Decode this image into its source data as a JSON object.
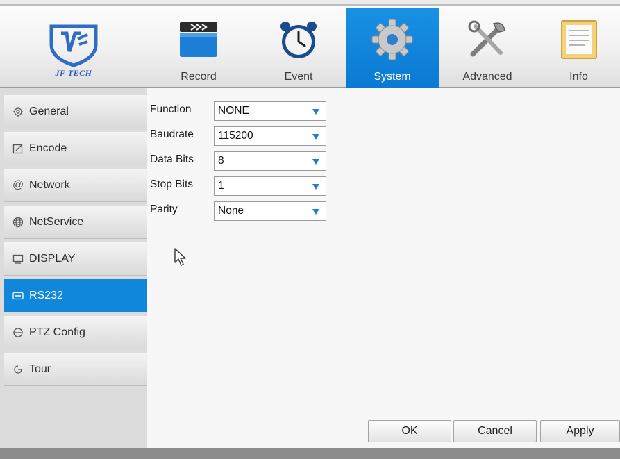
{
  "brand": {
    "logo_text": "JF TECH"
  },
  "tabs": [
    {
      "label": "Record",
      "icon": "record-clapper-icon",
      "active": false
    },
    {
      "label": "Event",
      "icon": "alarm-clock-icon",
      "active": false
    },
    {
      "label": "System",
      "icon": "gear-icon",
      "active": true
    },
    {
      "label": "Advanced",
      "icon": "tools-icon",
      "active": false
    },
    {
      "label": "Info",
      "icon": "info-document-icon",
      "active": false
    }
  ],
  "sidebar": {
    "items": [
      {
        "label": "General",
        "icon": "gear-icon"
      },
      {
        "label": "Encode",
        "icon": "edit-icon"
      },
      {
        "label": "Network",
        "icon": "at-icon"
      },
      {
        "label": "NetService",
        "icon": "globe-icon"
      },
      {
        "label": "DISPLAY",
        "icon": "monitor-icon"
      },
      {
        "label": "RS232",
        "icon": "serial-port-icon",
        "active": true
      },
      {
        "label": "PTZ Config",
        "icon": "ptz-icon"
      },
      {
        "label": "Tour",
        "icon": "tour-icon"
      }
    ]
  },
  "form": {
    "fields": [
      {
        "label": "Function",
        "value": "NONE"
      },
      {
        "label": "Baudrate",
        "value": "115200"
      },
      {
        "label": "Data Bits",
        "value": "8"
      },
      {
        "label": "Stop Bits",
        "value": "1"
      },
      {
        "label": "Parity",
        "value": "None"
      }
    ]
  },
  "buttons": {
    "ok": "OK",
    "cancel": "Cancel",
    "apply": "Apply"
  },
  "colors": {
    "accent": "#0a84d8",
    "dropdown_arrow": "#1a7fd6"
  }
}
